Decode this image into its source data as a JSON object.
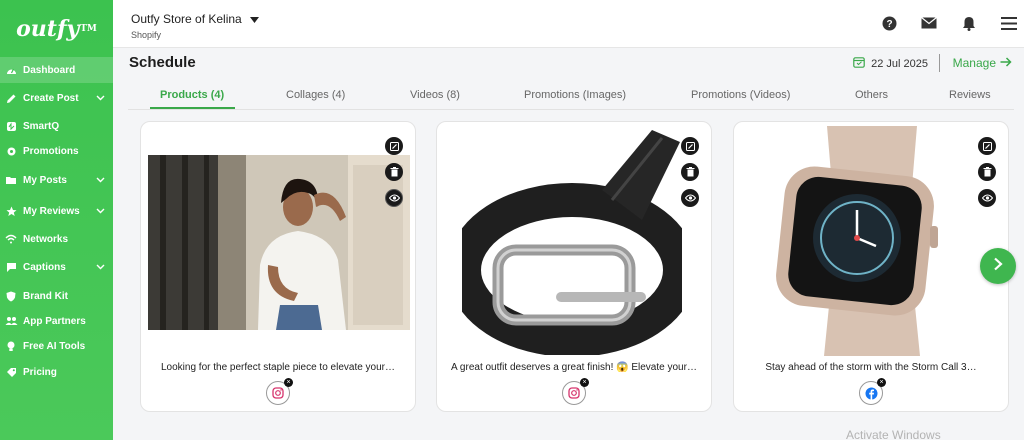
{
  "brand": {
    "logo_text": "outfy",
    "trademark": "TM"
  },
  "sidebar": {
    "items": [
      {
        "label": "Dashboard",
        "icon": "dashboard-icon"
      },
      {
        "label": "Create Post",
        "icon": "pencil-icon"
      },
      {
        "label": "SmartQ",
        "icon": "smartq-icon"
      },
      {
        "label": "Promotions",
        "icon": "gear-icon"
      },
      {
        "label": "My Posts",
        "icon": "folder-icon"
      },
      {
        "label": "My Reviews",
        "icon": "star-icon"
      },
      {
        "label": "Networks",
        "icon": "wifi-icon"
      },
      {
        "label": "Captions",
        "icon": "chat-icon"
      },
      {
        "label": "Brand Kit",
        "icon": "shield-icon"
      },
      {
        "label": "App Partners",
        "icon": "users-icon"
      },
      {
        "label": "Free AI Tools",
        "icon": "bulb-icon"
      },
      {
        "label": "Pricing",
        "icon": "tag-icon"
      }
    ]
  },
  "topbar": {
    "store_name": "Outfy Store of Kelina",
    "platform": "Shopify"
  },
  "header": {
    "title": "Schedule",
    "date": "22 Jul 2025",
    "manage_label": "Manage"
  },
  "tabs": [
    {
      "label": "Products (4)"
    },
    {
      "label": "Collages (4)"
    },
    {
      "label": "Videos (8)"
    },
    {
      "label": "Promotions (Images)"
    },
    {
      "label": "Promotions (Videos)"
    },
    {
      "label": "Others"
    },
    {
      "label": "Reviews"
    }
  ],
  "cards": [
    {
      "caption": "Looking for the perfect staple piece to elevate your…",
      "network": "instagram"
    },
    {
      "caption": "A great outfit deserves a great finish! 😱 Elevate your…",
      "network": "instagram"
    },
    {
      "caption": "Stay ahead of the storm with the Storm Call 3…",
      "network": "facebook"
    }
  ],
  "watermark": "Activate Windows",
  "colors": {
    "accent": "#3aa84a",
    "sidebar": "#3cc24f"
  }
}
